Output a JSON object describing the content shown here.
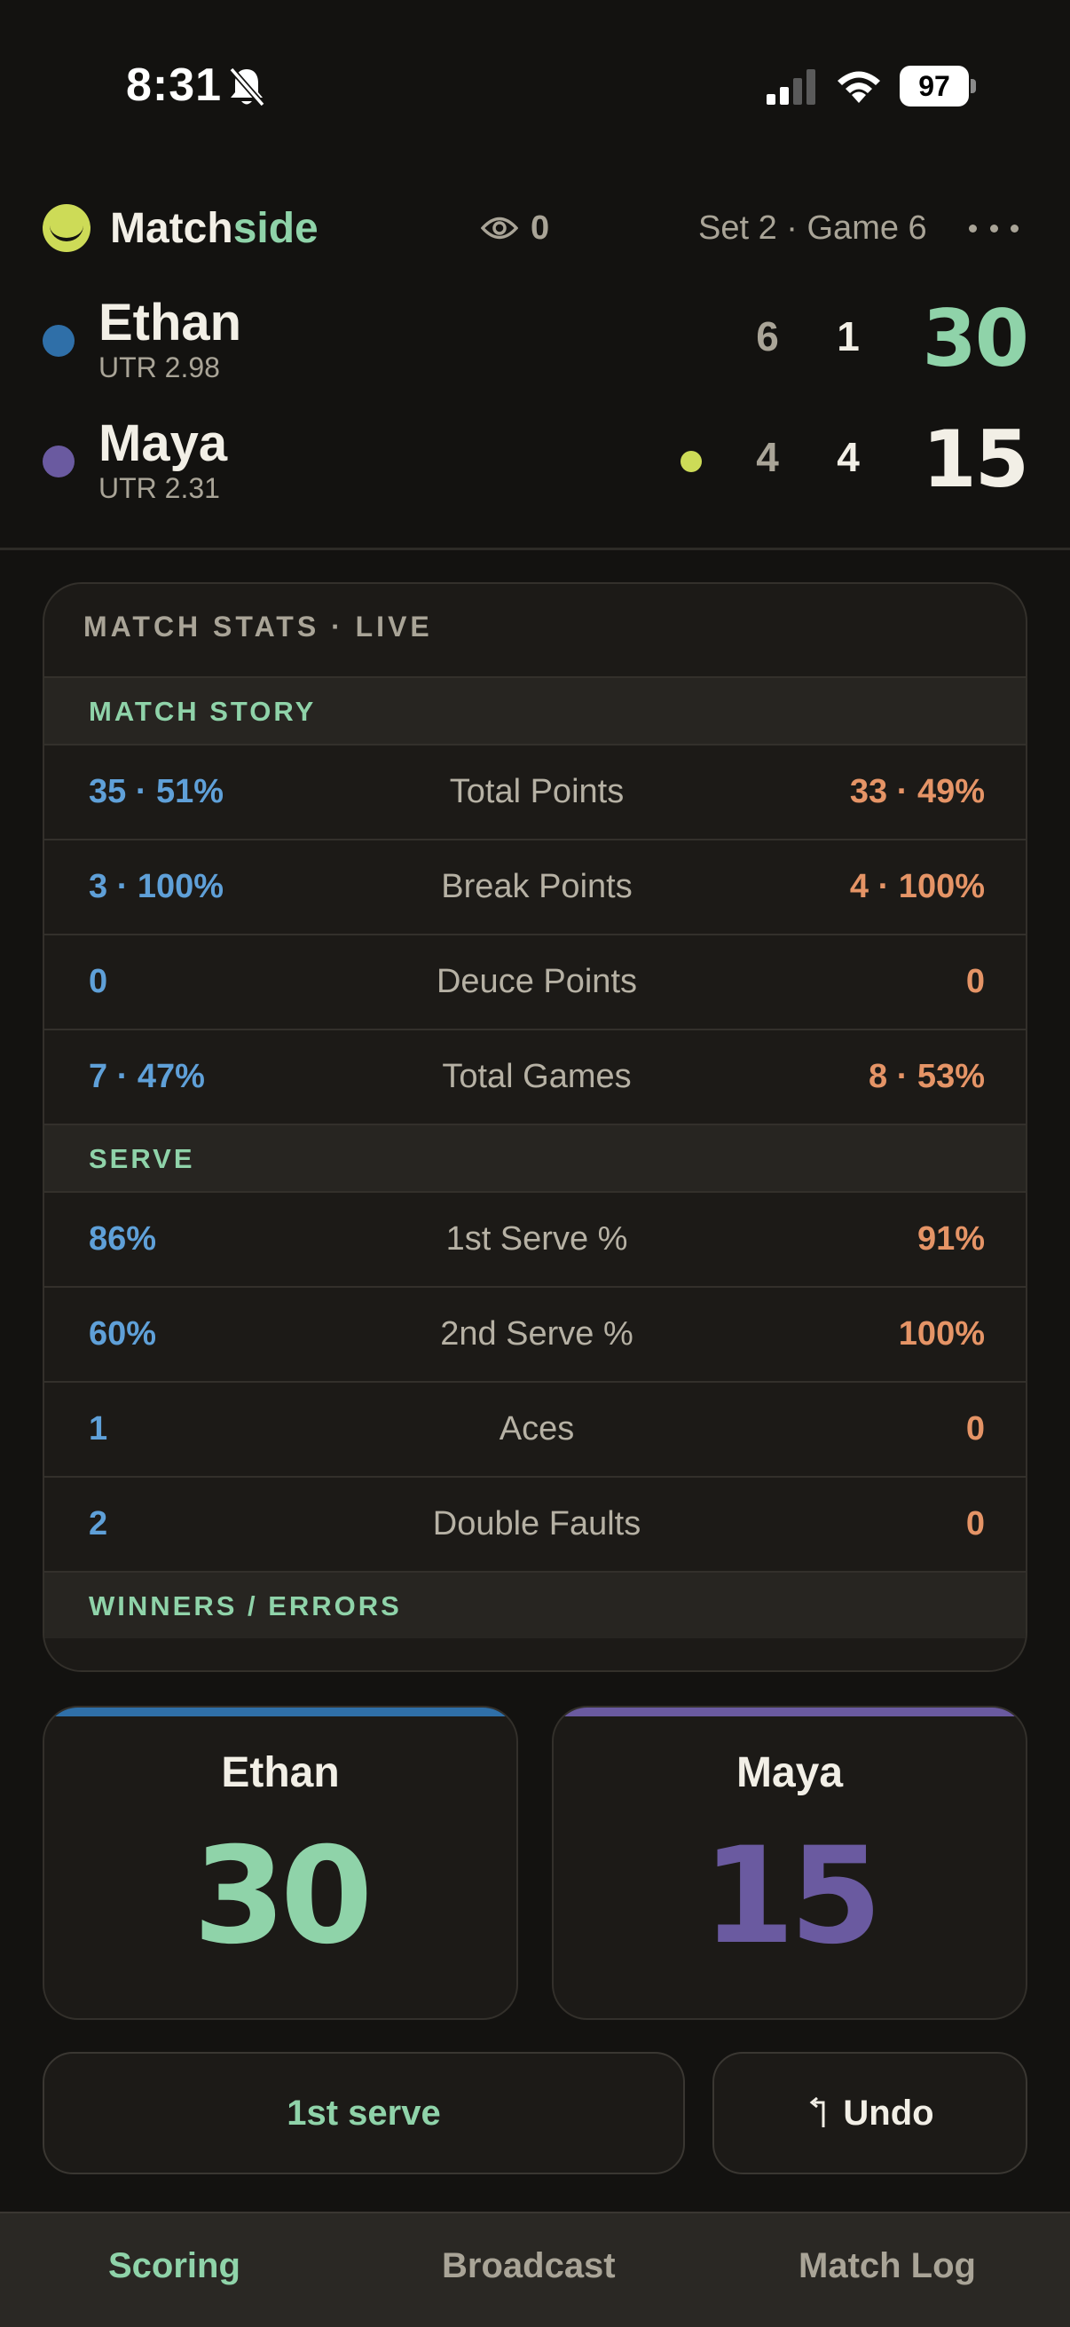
{
  "status": {
    "time": "8:31",
    "battery": "97"
  },
  "header": {
    "brand_a": "Match",
    "brand_b": "side",
    "viewers": "0",
    "set_info": "Set 2 · Game 6"
  },
  "players": [
    {
      "name": "Ethan",
      "utr": "UTR 2.98",
      "set1": "6",
      "set2": "1",
      "points": "30",
      "color": "#2f6fa8",
      "points_color": "#8fd3a9"
    },
    {
      "name": "Maya",
      "utr": "UTR 2.31",
      "set1": "4",
      "set2": "4",
      "points": "15",
      "color": "#6a5aa0",
      "points_color": "#f2efe6",
      "serving": true
    }
  ],
  "stats": {
    "title": "MATCH STATS · LIVE",
    "sections": [
      {
        "name": "MATCH STORY",
        "rows": [
          {
            "left": "35 · 51%",
            "label": "Total Points",
            "right": "33 · 49%"
          },
          {
            "left": "3 · 100%",
            "label": "Break Points",
            "right": "4 · 100%"
          },
          {
            "left": "0",
            "label": "Deuce Points",
            "right": "0"
          },
          {
            "left": "7 · 47%",
            "label": "Total Games",
            "right": "8 · 53%"
          }
        ]
      },
      {
        "name": "SERVE",
        "rows": [
          {
            "left": "86%",
            "label": "1st Serve %",
            "right": "91%"
          },
          {
            "left": "60%",
            "label": "2nd Serve %",
            "right": "100%"
          },
          {
            "left": "1",
            "label": "Aces",
            "right": "0"
          },
          {
            "left": "2",
            "label": "Double Faults",
            "right": "0"
          }
        ]
      },
      {
        "name": "WINNERS / ERRORS",
        "rows": []
      }
    ]
  },
  "score_cards": [
    {
      "name": "Ethan",
      "points": "30",
      "bar_color": "#2f6fa8",
      "points_color": "#8fd3a9"
    },
    {
      "name": "Maya",
      "points": "15",
      "bar_color": "#6a5aa0",
      "points_color": "#6a5aa0"
    }
  ],
  "actions": {
    "serve": "1st serve",
    "undo": "Undo"
  },
  "tabs": [
    {
      "label": "Scoring",
      "active": true
    },
    {
      "label": "Broadcast",
      "active": false
    },
    {
      "label": "Match Log",
      "active": false
    }
  ],
  "colors": {
    "accent": "#8fd3a9",
    "left_stat": "#5fa0d8",
    "right_stat": "#e59466",
    "ball": "#cddb57"
  }
}
